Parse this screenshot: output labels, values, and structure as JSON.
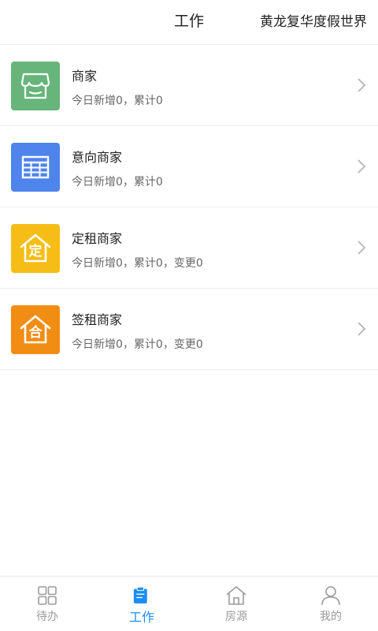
{
  "header": {
    "title": "工作",
    "project": "黄龙复华度假世界"
  },
  "rows": [
    {
      "name": "商家",
      "stats": "今日新增0，累计0",
      "color": "#67b57a",
      "icon": "shop-icon"
    },
    {
      "name": "意向商家",
      "stats": "今日新增0，累计0",
      "color": "#4f84ec",
      "icon": "table-icon"
    },
    {
      "name": "定租商家",
      "stats": "今日新增0，累计0，变更0",
      "color": "#f5bd16",
      "icon": "house-ding-icon",
      "badge": "定"
    },
    {
      "name": "签租商家",
      "stats": "今日新增0，累计0，变更0",
      "color": "#f28d14",
      "icon": "house-he-icon",
      "badge": "合"
    }
  ],
  "tabs": [
    {
      "label": "待办",
      "icon": "grid-icon",
      "active": false
    },
    {
      "label": "工作",
      "icon": "clipboard-icon",
      "active": true
    },
    {
      "label": "房源",
      "icon": "home-icon",
      "active": false
    },
    {
      "label": "我的",
      "icon": "person-icon",
      "active": false
    }
  ],
  "colors": {
    "accent": "#1a8ef2",
    "inactive": "#9a9a9a"
  }
}
